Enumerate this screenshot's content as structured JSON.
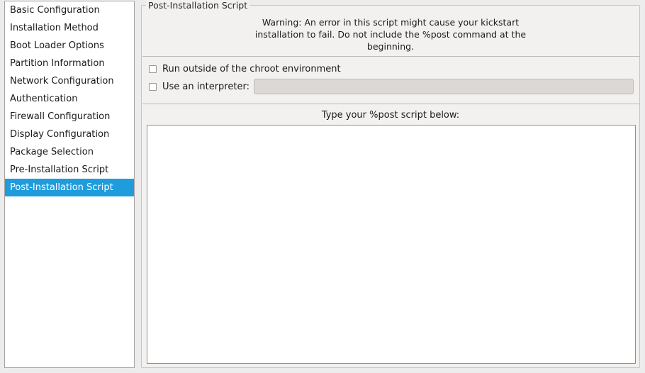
{
  "colors": {
    "window_bg": "#ececec",
    "panel_bg": "#f2f1f0",
    "selection": "#1f9cdc",
    "selection_text": "#ffffff",
    "list_bg": "#ffffff",
    "disabled_field": "#dcd8d5",
    "border": "#a8a19e",
    "text": "#1a1a1a"
  },
  "sidebar": {
    "items": [
      {
        "label": "Basic Configuration",
        "selected": false
      },
      {
        "label": "Installation Method",
        "selected": false
      },
      {
        "label": "Boot Loader Options",
        "selected": false
      },
      {
        "label": "Partition Information",
        "selected": false
      },
      {
        "label": "Network Configuration",
        "selected": false
      },
      {
        "label": "Authentication",
        "selected": false
      },
      {
        "label": "Firewall Configuration",
        "selected": false
      },
      {
        "label": "Display Configuration",
        "selected": false
      },
      {
        "label": "Package Selection",
        "selected": false
      },
      {
        "label": "Pre-Installation Script",
        "selected": false
      },
      {
        "label": "Post-Installation Script",
        "selected": true
      }
    ]
  },
  "panel": {
    "group_title": "Post-Installation Script",
    "warning": "Warning: An error in this script might cause your kickstart installation to fail. Do not include the %post command at the beginning.",
    "checkboxes": [
      {
        "label": "Run outside of the chroot environment",
        "checked": false
      },
      {
        "label": "Use an interpreter:",
        "checked": false
      }
    ],
    "interpreter_field": {
      "value": "",
      "placeholder": "",
      "enabled": false
    },
    "script_label": "Type your %post script below:",
    "script_textarea": {
      "value": "",
      "placeholder": ""
    }
  }
}
